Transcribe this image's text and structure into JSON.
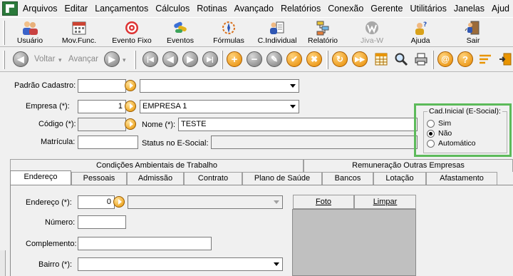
{
  "menu": [
    "Arquivos",
    "Editar",
    "Lançamentos",
    "Cálculos",
    "Rotinas",
    "Avançado",
    "Relatórios",
    "Conexão",
    "Gerente",
    "Utilitários",
    "Janelas",
    "Ajud"
  ],
  "toolbar1": [
    {
      "label": "Usuário",
      "icon": "users-icon",
      "enabled": true
    },
    {
      "label": "Mov.Func.",
      "icon": "calendar-icon",
      "enabled": true
    },
    {
      "label": "Evento Fixo",
      "icon": "target-icon",
      "enabled": true
    },
    {
      "label": "Eventos",
      "icon": "pills-icon",
      "enabled": true
    },
    {
      "label": "Fórmulas",
      "icon": "compass-icon",
      "enabled": true
    },
    {
      "label": "C.Individual",
      "icon": "person-doc-icon",
      "enabled": true
    },
    {
      "label": "Relatório",
      "icon": "flowchart-icon",
      "enabled": true
    },
    {
      "label": "Jiva-W",
      "icon": "jiva-logo-icon",
      "enabled": false
    },
    {
      "label": "Ajuda",
      "icon": "help-person-icon",
      "enabled": true
    },
    {
      "label": "Sair",
      "icon": "exit-door-icon",
      "enabled": true
    }
  ],
  "nav": {
    "back": "Voltar",
    "forward": "Avançar"
  },
  "form": {
    "padrao_label": "Padrão Cadastro:",
    "empresa_label": "Empresa (*):",
    "empresa_code": "1",
    "empresa_name": "EMPRESA 1",
    "codigo_label": "Código (*):",
    "nome_label": "Nome (*):",
    "nome_value": "TESTE",
    "matricula_label": "Matrícula:",
    "status_label": "Status no E-Social:"
  },
  "cad_inicial": {
    "title": "Cad.Inicial (E-Social):",
    "options": [
      "Sim",
      "Não",
      "Automático"
    ],
    "selected": "Não"
  },
  "tabs_top": [
    "Condições Ambientais de Trabalho",
    "Remuneração Outras Empresas"
  ],
  "tabs_main": [
    "Endereço",
    "Pessoais",
    "Admissão",
    "Contrato",
    "Plano de Saúde",
    "Bancos",
    "Lotação",
    "Afastamento"
  ],
  "active_tab": "Endereço",
  "address": {
    "endereco_label": "Endereço (*):",
    "endereco_code": "0",
    "numero_label": "Número:",
    "complemento_label": "Complemento:",
    "bairro_label": "Bairro (*):"
  },
  "photo": {
    "foto_label": "Foto",
    "limpar_label": "Limpar"
  }
}
